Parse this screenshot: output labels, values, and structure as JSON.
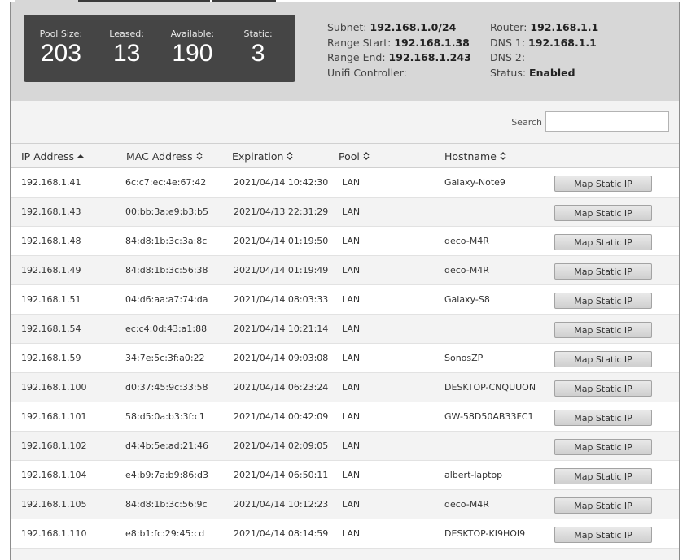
{
  "summary": {
    "stats": [
      {
        "label": "Pool Size:",
        "value": "203"
      },
      {
        "label": "Leased:",
        "value": "13"
      },
      {
        "label": "Available:",
        "value": "190"
      },
      {
        "label": "Static:",
        "value": "3"
      }
    ],
    "info_left": [
      {
        "label": "Subnet:",
        "value": "192.168.1.0/24"
      },
      {
        "label": "Range Start:",
        "value": "192.168.1.38"
      },
      {
        "label": "Range End:",
        "value": "192.168.1.243"
      },
      {
        "label": "Unifi Controller:",
        "value": ""
      }
    ],
    "info_right": [
      {
        "label": "Router:",
        "value": "192.168.1.1"
      },
      {
        "label": "DNS 1:",
        "value": "192.168.1.1"
      },
      {
        "label": "DNS 2:",
        "value": ""
      },
      {
        "label": "Status:",
        "value": "Enabled"
      }
    ]
  },
  "search": {
    "label": "Search",
    "value": "",
    "placeholder": ""
  },
  "table": {
    "columns": [
      {
        "label": "IP Address",
        "sort": "asc"
      },
      {
        "label": "MAC Address",
        "sort": "none"
      },
      {
        "label": "Expiration",
        "sort": "none"
      },
      {
        "label": "Pool",
        "sort": "none"
      },
      {
        "label": "Hostname",
        "sort": "none"
      }
    ],
    "button_label": "Map Static IP",
    "rows": [
      {
        "ip": "192.168.1.41",
        "mac": "6c:c7:ec:4e:67:42",
        "exp": "2021/04/14 10:42:30",
        "pool": "LAN",
        "host": "Galaxy-Note9"
      },
      {
        "ip": "192.168.1.43",
        "mac": "00:bb:3a:e9:b3:b5",
        "exp": "2021/04/13 22:31:29",
        "pool": "LAN",
        "host": ""
      },
      {
        "ip": "192.168.1.48",
        "mac": "84:d8:1b:3c:3a:8c",
        "exp": "2021/04/14 01:19:50",
        "pool": "LAN",
        "host": "deco-M4R"
      },
      {
        "ip": "192.168.1.49",
        "mac": "84:d8:1b:3c:56:38",
        "exp": "2021/04/14 01:19:49",
        "pool": "LAN",
        "host": "deco-M4R"
      },
      {
        "ip": "192.168.1.51",
        "mac": "04:d6:aa:a7:74:da",
        "exp": "2021/04/14 08:03:33",
        "pool": "LAN",
        "host": "Galaxy-S8"
      },
      {
        "ip": "192.168.1.54",
        "mac": "ec:c4:0d:43:a1:88",
        "exp": "2021/04/14 10:21:14",
        "pool": "LAN",
        "host": ""
      },
      {
        "ip": "192.168.1.59",
        "mac": "34:7e:5c:3f:a0:22",
        "exp": "2021/04/14 09:03:08",
        "pool": "LAN",
        "host": "SonosZP"
      },
      {
        "ip": "192.168.1.100",
        "mac": "d0:37:45:9c:33:58",
        "exp": "2021/04/14 06:23:24",
        "pool": "LAN",
        "host": "DESKTOP-CNQUUON"
      },
      {
        "ip": "192.168.1.101",
        "mac": "58:d5:0a:b3:3f:c1",
        "exp": "2021/04/14 00:42:09",
        "pool": "LAN",
        "host": "GW-58D50AB33FC1"
      },
      {
        "ip": "192.168.1.102",
        "mac": "d4:4b:5e:ad:21:46",
        "exp": "2021/04/14 02:09:05",
        "pool": "LAN",
        "host": ""
      },
      {
        "ip": "192.168.1.104",
        "mac": "e4:b9:7a:b9:86:d3",
        "exp": "2021/04/14 06:50:11",
        "pool": "LAN",
        "host": "albert-laptop"
      },
      {
        "ip": "192.168.1.105",
        "mac": "84:d8:1b:3c:56:9c",
        "exp": "2021/04/14 10:12:23",
        "pool": "LAN",
        "host": "deco-M4R"
      },
      {
        "ip": "192.168.1.110",
        "mac": "e8:b1:fc:29:45:cd",
        "exp": "2021/04/14 08:14:59",
        "pool": "LAN",
        "host": "DESKTOP-KI9HOI9"
      }
    ]
  }
}
